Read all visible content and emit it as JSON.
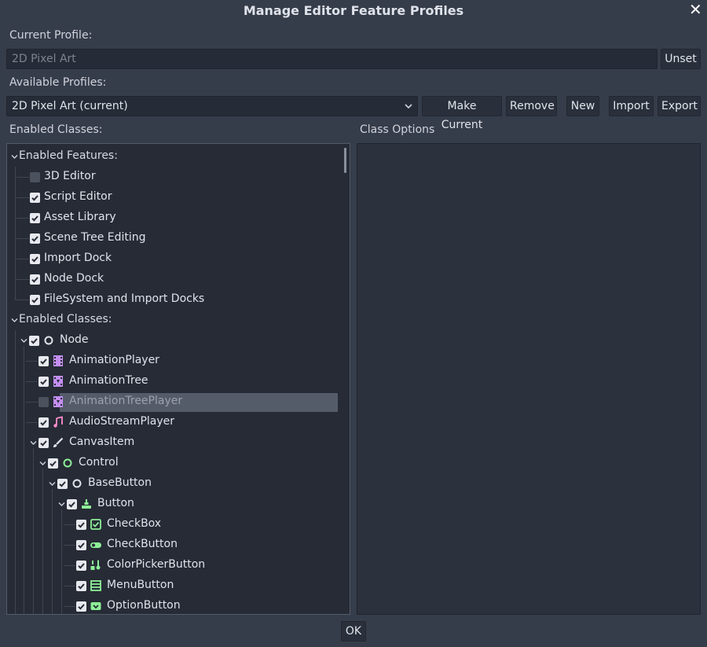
{
  "window": {
    "title": "Manage Editor Feature Profiles"
  },
  "current_profile": {
    "label": "Current Profile:",
    "value": "2D Pixel Art",
    "unset_label": "Unset"
  },
  "available_profiles": {
    "label": "Available Profiles:",
    "selected": "2D Pixel Art (current)",
    "buttons": {
      "make_current": "Make Current",
      "remove": "Remove",
      "new": "New",
      "import": "Import",
      "export": "Export"
    }
  },
  "enabled_classes_label": "Enabled Classes:",
  "class_options_label": "Class Options",
  "tree": {
    "features_header": "Enabled Features:",
    "features": [
      {
        "label": "3D Editor",
        "checked": false
      },
      {
        "label": "Script Editor",
        "checked": true
      },
      {
        "label": "Asset Library",
        "checked": true
      },
      {
        "label": "Scene Tree Editing",
        "checked": true
      },
      {
        "label": "Import Dock",
        "checked": true
      },
      {
        "label": "Node Dock",
        "checked": true
      },
      {
        "label": "FileSystem and Import Docks",
        "checked": true
      }
    ],
    "classes_header": "Enabled Classes:",
    "classes": [
      {
        "label": "Node",
        "depth": 0,
        "checked": true,
        "expanded": true,
        "icon": "node-icon",
        "color": "#e0e3ea"
      },
      {
        "label": "AnimationPlayer",
        "depth": 1,
        "checked": true,
        "icon": "animation-player-icon",
        "color": "#c38ef1"
      },
      {
        "label": "AnimationTree",
        "depth": 1,
        "checked": true,
        "icon": "animation-tree-icon",
        "color": "#c38ef1"
      },
      {
        "label": "AnimationTreePlayer",
        "depth": 1,
        "checked": false,
        "icon": "animation-tree-player-icon",
        "color": "#c38ef1",
        "selected": true
      },
      {
        "label": "AudioStreamPlayer",
        "depth": 1,
        "checked": true,
        "icon": "audio-stream-player-icon",
        "color": "#ff8ccc"
      },
      {
        "label": "CanvasItem",
        "depth": 1,
        "checked": true,
        "expanded": true,
        "icon": "canvas-item-icon",
        "color": "#e0e3ea"
      },
      {
        "label": "Control",
        "depth": 2,
        "checked": true,
        "expanded": true,
        "icon": "control-icon",
        "color": "#8eef97"
      },
      {
        "label": "BaseButton",
        "depth": 3,
        "checked": true,
        "expanded": true,
        "icon": "base-button-icon",
        "color": "#e0e3ea"
      },
      {
        "label": "Button",
        "depth": 4,
        "checked": true,
        "expanded": true,
        "icon": "button-icon",
        "color": "#8eef97"
      },
      {
        "label": "CheckBox",
        "depth": 5,
        "checked": true,
        "icon": "checkbox-icon",
        "color": "#8eef97"
      },
      {
        "label": "CheckButton",
        "depth": 5,
        "checked": true,
        "icon": "check-button-icon",
        "color": "#8eef97"
      },
      {
        "label": "ColorPickerButton",
        "depth": 5,
        "checked": true,
        "icon": "color-picker-button-icon",
        "color": "#8eef97"
      },
      {
        "label": "MenuButton",
        "depth": 5,
        "checked": true,
        "icon": "menu-button-icon",
        "color": "#8eef97"
      },
      {
        "label": "OptionButton",
        "depth": 5,
        "checked": true,
        "icon": "option-button-icon",
        "color": "#8eef97"
      }
    ]
  },
  "ok_label": "OK"
}
